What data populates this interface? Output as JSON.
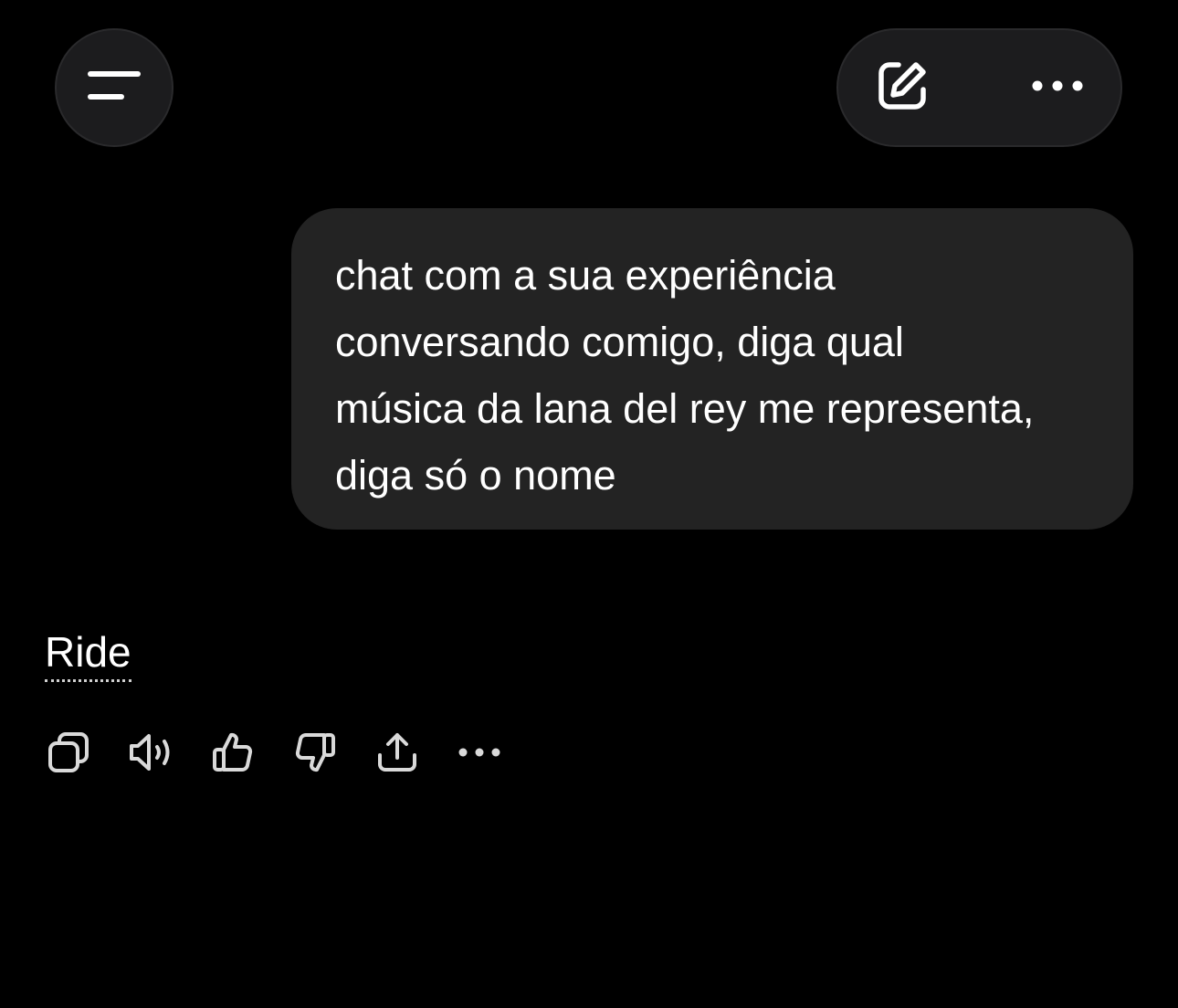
{
  "header": {
    "menu_icon": "menu-lines-icon",
    "new_chat_icon": "edit-square-icon",
    "more_icon": "more-horizontal-icon"
  },
  "conversation": {
    "user_message": "chat com a sua experiência\nconversando comigo, diga qual\nmúsica da lana del rey me representa,\ndiga só o nome",
    "assistant_reply": "Ride"
  },
  "message_actions": [
    {
      "name": "copy",
      "icon": "copy-icon"
    },
    {
      "name": "read-aloud",
      "icon": "speaker-icon"
    },
    {
      "name": "good-response",
      "icon": "thumbs-up-icon"
    },
    {
      "name": "bad-response",
      "icon": "thumbs-down-icon"
    },
    {
      "name": "share",
      "icon": "share-icon"
    },
    {
      "name": "more-actions",
      "icon": "more-horizontal-icon"
    }
  ],
  "colors": {
    "background": "#000000",
    "surface": "#1c1c1e",
    "bubble": "#232323",
    "text": "#ffffff",
    "icon": "#d9d9d9"
  }
}
